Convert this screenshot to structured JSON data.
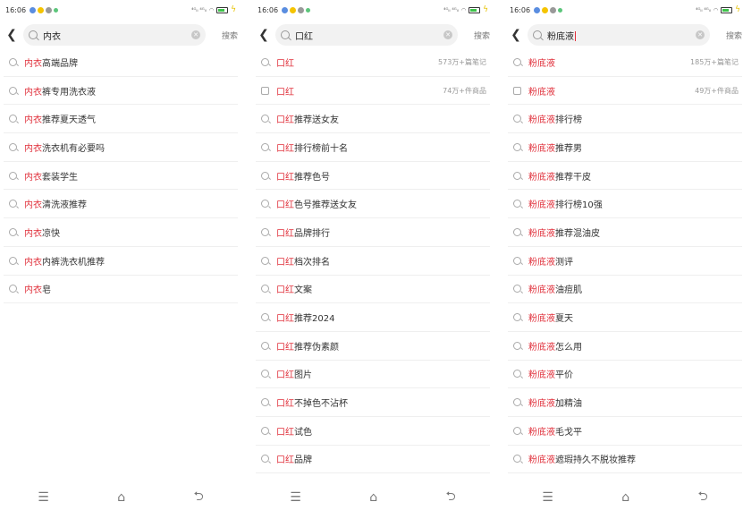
{
  "statusbar": {
    "time": "16:06",
    "signal_text": "⁴ᴳᵢₗ ⁴ᴳᵢₗ"
  },
  "colors": {
    "accent": "#e0303b"
  },
  "icons": {
    "back": "chevron-left-icon",
    "search": "search-icon",
    "clear": "clear-icon",
    "shop": "shop-icon"
  },
  "search_button_label": "搜索",
  "panels": [
    {
      "query": "内衣",
      "keyword": "内衣",
      "show_caret": false,
      "rows": [
        {
          "kw": "内衣",
          "rest": "高端品牌",
          "meta": "",
          "icon": "search"
        },
        {
          "kw": "内衣",
          "rest": "裤专用洗衣液",
          "meta": "",
          "icon": "search"
        },
        {
          "kw": "内衣",
          "rest": "推荐夏天透气",
          "meta": "",
          "icon": "search"
        },
        {
          "kw": "内衣",
          "rest": "洗衣机有必要吗",
          "meta": "",
          "icon": "search"
        },
        {
          "kw": "内衣",
          "rest": "套装学生",
          "meta": "",
          "icon": "search"
        },
        {
          "kw": "内衣",
          "rest": "清洗液推荐",
          "meta": "",
          "icon": "search"
        },
        {
          "kw": "内衣",
          "rest": "凉快",
          "meta": "",
          "icon": "search"
        },
        {
          "kw": "内衣",
          "rest": "内裤洗衣机推荐",
          "meta": "",
          "icon": "search"
        },
        {
          "kw": "内衣",
          "rest": "皂",
          "meta": "",
          "icon": "search"
        }
      ]
    },
    {
      "query": "口红",
      "keyword": "口红",
      "show_caret": false,
      "rows": [
        {
          "kw": "口红",
          "rest": "",
          "meta": "573万+篇笔记",
          "icon": "search"
        },
        {
          "kw": "口红",
          "rest": "",
          "meta": "74万+件商品",
          "icon": "shop"
        },
        {
          "kw": "口红",
          "rest": "推荐送女友",
          "meta": "",
          "icon": "search"
        },
        {
          "kw": "口红",
          "rest": "排行榜前十名",
          "meta": "",
          "icon": "search"
        },
        {
          "kw": "口红",
          "rest": "推荐色号",
          "meta": "",
          "icon": "search"
        },
        {
          "kw": "口红",
          "rest": "色号推荐送女友",
          "meta": "",
          "icon": "search"
        },
        {
          "kw": "口红",
          "rest": "品牌排行",
          "meta": "",
          "icon": "search"
        },
        {
          "kw": "口红",
          "rest": "档次排名",
          "meta": "",
          "icon": "search"
        },
        {
          "kw": "口红",
          "rest": "文案",
          "meta": "",
          "icon": "search"
        },
        {
          "kw": "口红",
          "rest": "推荐2024",
          "meta": "",
          "icon": "search"
        },
        {
          "kw": "口红",
          "rest": "推荐伪素颜",
          "meta": "",
          "icon": "search"
        },
        {
          "kw": "口红",
          "rest": "图片",
          "meta": "",
          "icon": "search"
        },
        {
          "kw": "口红",
          "rest": "不掉色不沾杯",
          "meta": "",
          "icon": "search"
        },
        {
          "kw": "口红",
          "rest": "试色",
          "meta": "",
          "icon": "search"
        },
        {
          "kw": "口红",
          "rest": "品牌",
          "meta": "",
          "icon": "search"
        }
      ]
    },
    {
      "query": "粉底液",
      "keyword": "粉底液",
      "show_caret": true,
      "rows": [
        {
          "kw": "粉底液",
          "rest": "",
          "meta": "185万+篇笔记",
          "icon": "search"
        },
        {
          "kw": "粉底液",
          "rest": "",
          "meta": "49万+件商品",
          "icon": "shop"
        },
        {
          "kw": "粉底液",
          "rest": "排行榜",
          "meta": "",
          "icon": "search"
        },
        {
          "kw": "粉底液",
          "rest": "推荐男",
          "meta": "",
          "icon": "search"
        },
        {
          "kw": "粉底液",
          "rest": "推荐干皮",
          "meta": "",
          "icon": "search"
        },
        {
          "kw": "粉底液",
          "rest": "排行榜10强",
          "meta": "",
          "icon": "search"
        },
        {
          "kw": "粉底液",
          "rest": "推荐混油皮",
          "meta": "",
          "icon": "search"
        },
        {
          "kw": "粉底液",
          "rest": "测评",
          "meta": "",
          "icon": "search"
        },
        {
          "kw": "粉底液",
          "rest": "油痘肌",
          "meta": "",
          "icon": "search"
        },
        {
          "kw": "粉底液",
          "rest": "夏天",
          "meta": "",
          "icon": "search"
        },
        {
          "kw": "粉底液",
          "rest": "怎么用",
          "meta": "",
          "icon": "search"
        },
        {
          "kw": "粉底液",
          "rest": "平价",
          "meta": "",
          "icon": "search"
        },
        {
          "kw": "粉底液",
          "rest": "加精油",
          "meta": "",
          "icon": "search"
        },
        {
          "kw": "粉底液",
          "rest": "毛戈平",
          "meta": "",
          "icon": "search"
        },
        {
          "kw": "粉底液",
          "rest": "遮瑕持久不脱妆推荐",
          "meta": "",
          "icon": "search"
        }
      ]
    }
  ],
  "navbar": {
    "menu_icon": "menu-icon",
    "home_icon": "home-icon",
    "back_icon": "back-nav-icon"
  }
}
